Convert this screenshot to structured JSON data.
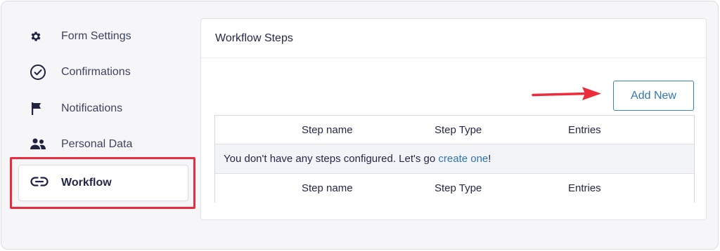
{
  "sidebar": {
    "items": [
      {
        "label": "Form Settings",
        "icon": "gear-icon"
      },
      {
        "label": "Confirmations",
        "icon": "check-circle-icon"
      },
      {
        "label": "Notifications",
        "icon": "flag-icon"
      },
      {
        "label": "Personal Data",
        "icon": "users-icon"
      }
    ],
    "active": {
      "label": "Workflow",
      "icon": "link-icon"
    }
  },
  "panel": {
    "title": "Workflow Steps",
    "add_new_label": "Add New",
    "table": {
      "columns": [
        "Step name",
        "Step Type",
        "Entries"
      ],
      "empty_message_prefix": "You don't have any steps configured. Let's go ",
      "empty_message_link": "create one",
      "empty_message_suffix": "!"
    }
  },
  "colors": {
    "highlight": "#ea2c3f",
    "accent": "#3179ad",
    "arrow": "#ee2b3b"
  }
}
